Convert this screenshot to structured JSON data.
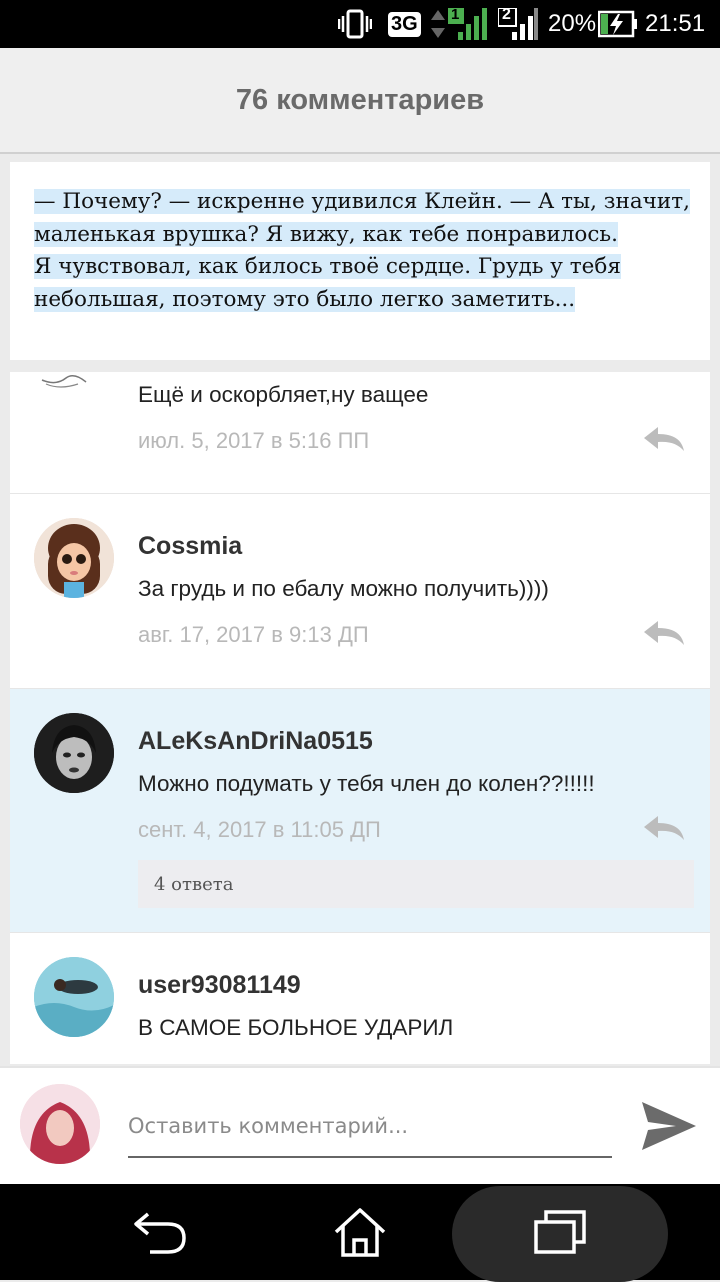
{
  "status_bar": {
    "network": "3G",
    "sim1": "1",
    "sim2": "2",
    "battery": "20%",
    "time": "21:51"
  },
  "header": {
    "title": "76 комментариев"
  },
  "quote": {
    "lines": [
      "— Почему? — искренне удивился Клейн. — А ты, значит,",
      "маленькая врушка? Я вижу, как тебе понравилось.",
      "Я чувствовал, как билось твоё сердце. Грудь у тебя",
      "небольшая, поэтому это было легко заметить..."
    ]
  },
  "comments": [
    {
      "text": "Ещё и оскорбляет,ну ващее",
      "date": "июл. 5, 2017 в 5:16 ПП"
    },
    {
      "user": "Cossmia",
      "text": "За грудь и по ебалу можно получить))))",
      "date": "авг. 17, 2017 в 9:13 ДП"
    },
    {
      "user": "ALeKsAnDriNa0515",
      "text": "Можно подумать у тебя член до колен??!!!!!",
      "date": "сент. 4, 2017 в 11:05 ДП",
      "replies": "4 ответа"
    },
    {
      "user": "user93081149",
      "text": "В САМОЕ БОЛЬНОЕ УДАРИЛ"
    }
  ],
  "comment_input": {
    "placeholder": "Оставить комментарий..."
  },
  "colors": {
    "highlight_bg": "#e6f3fa",
    "selection": "#d6ebfa",
    "battery_green": "#4caf50"
  },
  "icons": [
    "vibrate-icon",
    "signal-icon",
    "battery-charging-icon",
    "reply-icon",
    "send-icon",
    "back-icon",
    "home-icon",
    "recents-icon"
  ]
}
